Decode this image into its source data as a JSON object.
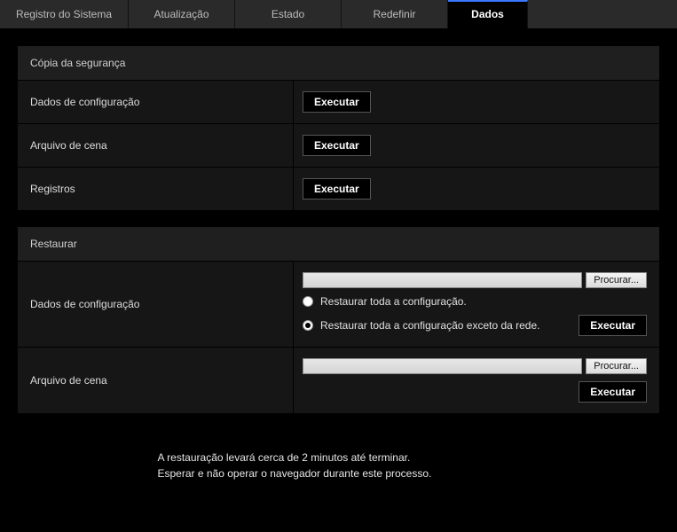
{
  "tabs": {
    "items": [
      {
        "label": "Registro do Sistema"
      },
      {
        "label": "Atualização"
      },
      {
        "label": "Estado"
      },
      {
        "label": "Redefinir"
      },
      {
        "label": "Dados"
      }
    ],
    "active_index": 4
  },
  "backup": {
    "header": "Cópia da segurança",
    "rows": [
      {
        "label": "Dados de configuração",
        "button": "Executar"
      },
      {
        "label": "Arquivo de cena",
        "button": "Executar"
      },
      {
        "label": "Registros",
        "button": "Executar"
      }
    ]
  },
  "restore": {
    "header": "Restaurar",
    "browse_button": "Procurar...",
    "execute_button": "Executar",
    "config": {
      "label": "Dados de configuração",
      "radio_all": "Restaurar toda a configuração.",
      "radio_except_net": "Restaurar toda a configuração exceto da rede.",
      "selected": "except_net"
    },
    "scene": {
      "label": "Arquivo de cena"
    }
  },
  "note": {
    "line1": "A restauração levará cerca de 2 minutos até terminar.",
    "line2": "Esperar e não operar o navegador durante este processo."
  }
}
